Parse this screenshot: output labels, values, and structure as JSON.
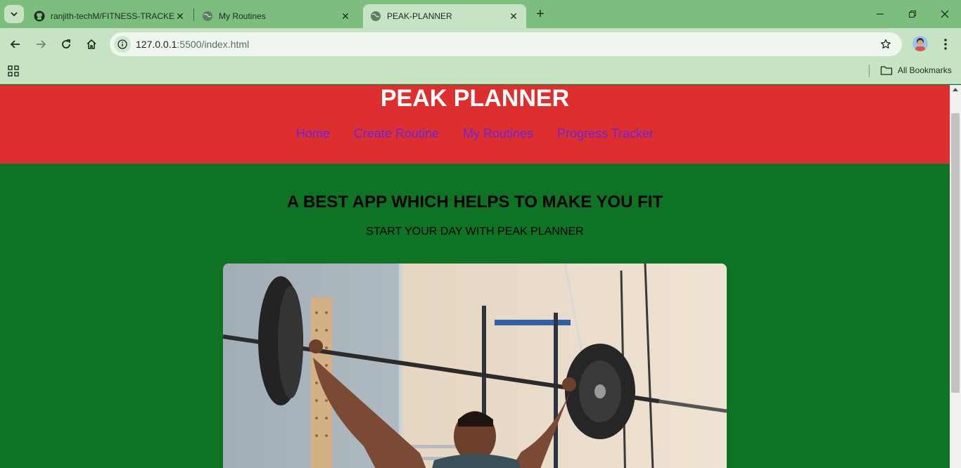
{
  "browser": {
    "tabs": [
      {
        "title": "ranjith-techM/FITNESS-TRACKER",
        "icon": "github-icon",
        "active": false
      },
      {
        "title": "My Routines",
        "icon": "globe-icon",
        "active": false
      },
      {
        "title": "PEAK-PLANNER",
        "icon": "globe-icon",
        "active": true
      }
    ],
    "url_host": "127.0.0.1",
    "url_rest": ":5500/index.html",
    "bookmarks_all_label": "All Bookmarks"
  },
  "site": {
    "title": "PEAK PLANNER",
    "nav": [
      "Home",
      "Create Routine",
      "My Routines",
      "Progress Tracker"
    ],
    "hero_title": "A BEST APP WHICH HELPS TO MAKE YOU FIT",
    "hero_subtitle": "START YOUR DAY WITH PEAK PLANNER",
    "hero_image": "weightlifter-photo"
  },
  "colors": {
    "header_bg": "#dd2f2f",
    "page_bg": "#0e7325",
    "nav_link": "#6f24d8",
    "browser_frame": "#7dbe7f"
  }
}
